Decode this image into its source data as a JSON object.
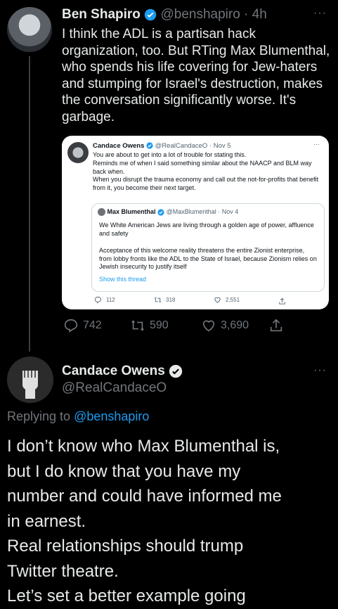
{
  "tweet1": {
    "name": "Ben Shapiro",
    "handle": "@benshapiro · 4h",
    "text": "I think the ADL is a partisan hack organization, too. But RTing Max Blumenthal, who spends his life covering for Jew-haters and stumping for Israel's destruction, makes the conversation significantly worse. It's garbage.",
    "more": "···",
    "actions": {
      "replies": "742",
      "retweets": "590",
      "likes": "3,690"
    }
  },
  "quoted": {
    "name": "Candace Owens",
    "handle": "@RealCandaceO · Nov 5",
    "line1": "You are about to get into a lot of trouble for stating this.",
    "line2": "Reminds me of when I said something similar about the NAACP and BLM way back when.",
    "line3": "When you disrupt the trauma economy and call out the not-for-profits that benefit from it, you become their next target.",
    "more": "···",
    "actions": {
      "replies": "112",
      "retweets": "318",
      "likes": "2,551"
    },
    "inner": {
      "name": "Max Blumenthal",
      "handle": "@MaxBlumenthal · Nov 4",
      "p1": "We White American Jews are living through a golden age of power, affluence and safety",
      "p2": "Acceptance of this welcome reality threatens the entire Zionist enterprise, from lobby fronts like the ADL to the State of Israel, because Zionism relies on Jewish insecurity to justify itself",
      "link": "Show this thread"
    }
  },
  "tweet2": {
    "name": "Candace Owens",
    "handle": "@RealCandaceO",
    "replying_prefix": "Replying to ",
    "replying_to": "@benshapiro",
    "text_lines": [
      "I don’t know who Max Blumenthal is,",
      "but I do know that you have my",
      "number and could have informed me",
      "in earnest.",
      "Real relationships should trump",
      "Twitter theatre.",
      "Let’s set a better example going"
    ],
    "more": "···"
  },
  "colors": {
    "background": "#000000",
    "link": "#1d9bf0",
    "verified": "#1d9bf0"
  }
}
